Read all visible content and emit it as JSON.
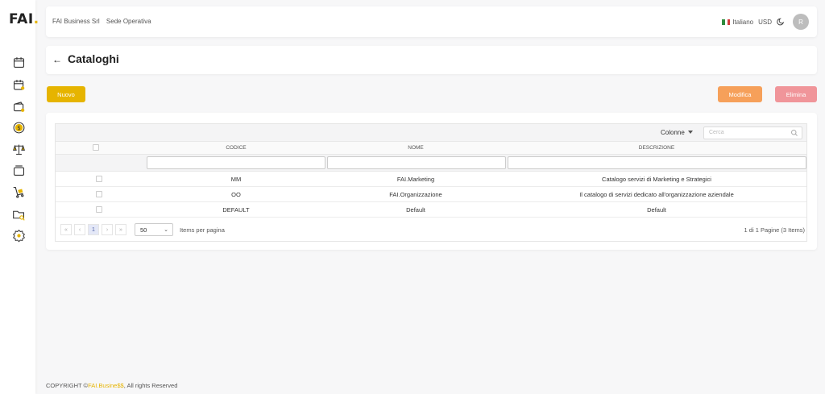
{
  "app": {
    "logo_text": "FAI",
    "logo_dot": "."
  },
  "header": {
    "company": "FAI Business Srl",
    "location": "Sede Operativa",
    "language": "Italiano",
    "currency": "USD",
    "avatar_initial": "R"
  },
  "page": {
    "title": "Cataloghi"
  },
  "actions": {
    "new_label": "Nuovo",
    "edit_label": "Modifica",
    "delete_label": "Elimina"
  },
  "grid": {
    "columns_label": "Colonne",
    "search_placeholder": "Cerca",
    "headers": {
      "code": "CODICE",
      "name": "NOME",
      "description": "DESCRIZIONE"
    },
    "rows": [
      {
        "code": "MM",
        "name": "FAI.Marketing",
        "description": "Catalogo servizi di Marketing e Strategici"
      },
      {
        "code": "OO",
        "name": "FAI.Organizzazione",
        "description": "Il catalogo di servizi dedicato all'organizzazione aziendale"
      },
      {
        "code": "DEFAULT",
        "name": "Default",
        "description": "Default"
      }
    ]
  },
  "pagination": {
    "first": "«",
    "prev": "‹",
    "current": "1",
    "next": "›",
    "last": "»",
    "page_size": "50",
    "items_per_page_label": "Items per pagina",
    "info": "1 di 1 Pagine (3 Items)"
  },
  "footer": {
    "prefix": "COPYRIGHT ©",
    "brand": "FAI.Busine$$",
    "suffix": ", All rights Reserved"
  },
  "colors": {
    "accent": "#e6b400",
    "edit": "#f6a05a",
    "delete": "#f0959a"
  },
  "sidebar_icons": [
    "calendar-icon",
    "calendar-user-icon",
    "wallet-icon",
    "dollar-coin-icon",
    "scale-icon",
    "stack-icon",
    "cart-icon",
    "folder-search-icon",
    "settings-icon"
  ]
}
